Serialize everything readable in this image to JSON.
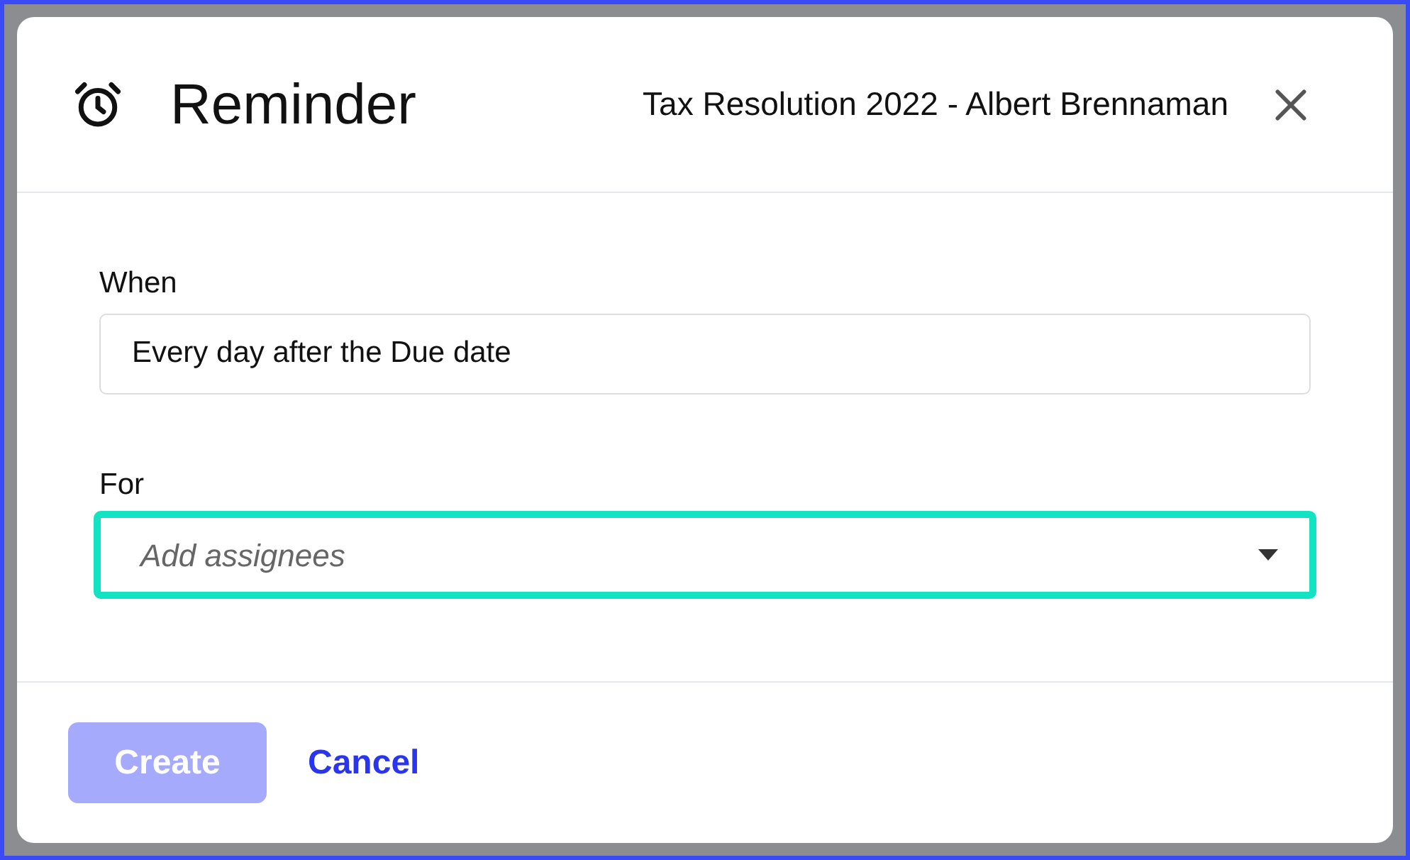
{
  "dialog": {
    "title": "Reminder",
    "subtitle": "Tax Resolution 2022 - Albert Brennaman"
  },
  "fields": [
    {
      "kind": "text",
      "label": "When",
      "value": "Every day after the Due date",
      "focused": false
    },
    {
      "kind": "select",
      "label": "For",
      "placeholder": "Add assignees",
      "focused": true
    }
  ],
  "buttons": [
    {
      "kind": "primary",
      "label": "Create",
      "disabled": true
    },
    {
      "kind": "link",
      "label": "Cancel",
      "disabled": false
    }
  ]
}
